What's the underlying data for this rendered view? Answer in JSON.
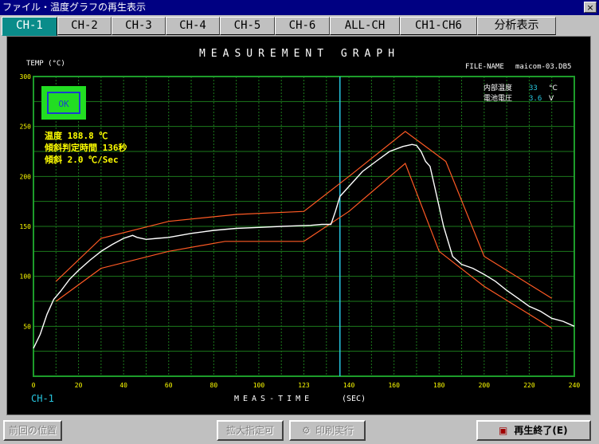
{
  "window": {
    "title": "ファイル・温度グラフの再生表示",
    "close_label": "×"
  },
  "tabs": [
    "CH-1",
    "CH-2",
    "CH-3",
    "CH-4",
    "CH-5",
    "CH-6",
    "ALL-CH",
    "CH1-CH6",
    "分析表示"
  ],
  "active_tab": "CH-1",
  "graph": {
    "title": "MEASUREMENT GRAPH",
    "ylabel": "TEMP (°C)",
    "file_label": "FILE-NAME",
    "file_name": "maicom-03.DB5",
    "internal_temp_label": "内部温度",
    "internal_temp_value": "33",
    "internal_temp_unit": "°C",
    "battery_label": "電池電圧",
    "battery_value": "3.6",
    "battery_unit": "V",
    "ok_label": "OK",
    "reading_temp": "温度 188.8 ℃",
    "reading_time": "傾斜判定時間 136秒",
    "reading_slope": "傾斜 2.0 ℃/Sec",
    "channel_label": "CH-1",
    "xlabel": "MEAS-TIME",
    "xunit": "(SEC)",
    "colors": {
      "grid": "#1c7a1c",
      "axis": "#1d9c2a",
      "curve": "#ffffff",
      "limits": "#ff5a24",
      "cursor": "#27c6e0",
      "text": "#ffffff",
      "yellow_text": "#ffff00",
      "tick": "#ffff00",
      "cyan_text": "#27c6e0"
    }
  },
  "chart_data": {
    "type": "line",
    "xlim": [
      0,
      240
    ],
    "ylim": [
      0,
      300
    ],
    "x_ticks": [
      0,
      20,
      40,
      60,
      80,
      100,
      120,
      140,
      160,
      180,
      200,
      220,
      240
    ],
    "x_tick_labels": [
      "0",
      "20",
      "40",
      "60",
      "80",
      "100",
      "123",
      "140",
      "160",
      "180",
      "200",
      "220",
      "240"
    ],
    "y_ticks": [
      50,
      100,
      150,
      200,
      250,
      300
    ],
    "y_tick_labels": [
      "50",
      "100",
      "150",
      "200",
      "250",
      "300"
    ],
    "cursor_x": 136,
    "series": [
      {
        "role": "measured",
        "color": "#ffffff",
        "x": [
          0,
          3,
          6,
          9,
          12,
          16,
          20,
          25,
          30,
          35,
          40,
          44,
          46,
          50,
          55,
          60,
          70,
          80,
          90,
          100,
          110,
          123,
          128,
          132,
          134,
          136,
          140,
          146,
          152,
          158,
          164,
          168,
          170,
          172,
          174,
          176,
          178,
          182,
          186,
          190,
          195,
          200,
          205,
          210,
          215,
          220,
          225,
          230,
          235,
          240
        ],
        "y": [
          28,
          42,
          62,
          77,
          85,
          97,
          106,
          116,
          125,
          132,
          138,
          141,
          139,
          137,
          138,
          139,
          143,
          146,
          148,
          149,
          150,
          151,
          152,
          152,
          165,
          180,
          190,
          205,
          215,
          225,
          230,
          232,
          231,
          225,
          215,
          210,
          190,
          150,
          120,
          112,
          108,
          102,
          95,
          86,
          78,
          70,
          65,
          58,
          55,
          50
        ]
      },
      {
        "role": "upper-limit",
        "color": "#ff5a24",
        "x": [
          10,
          30,
          60,
          90,
          120,
          140,
          165,
          183,
          200,
          230
        ],
        "y": [
          95,
          138,
          155,
          162,
          165,
          200,
          245,
          215,
          120,
          78
        ]
      },
      {
        "role": "lower-limit",
        "color": "#ff5a24",
        "x": [
          10,
          30,
          60,
          85,
          120,
          140,
          165,
          180,
          200,
          230
        ],
        "y": [
          75,
          108,
          125,
          135,
          135,
          165,
          213,
          125,
          90,
          48
        ]
      }
    ]
  },
  "buttons": {
    "prev_pos": "前回の位置",
    "zoom": "拡大指定可",
    "print": "印刷実行",
    "end": "再生終了(E)"
  }
}
